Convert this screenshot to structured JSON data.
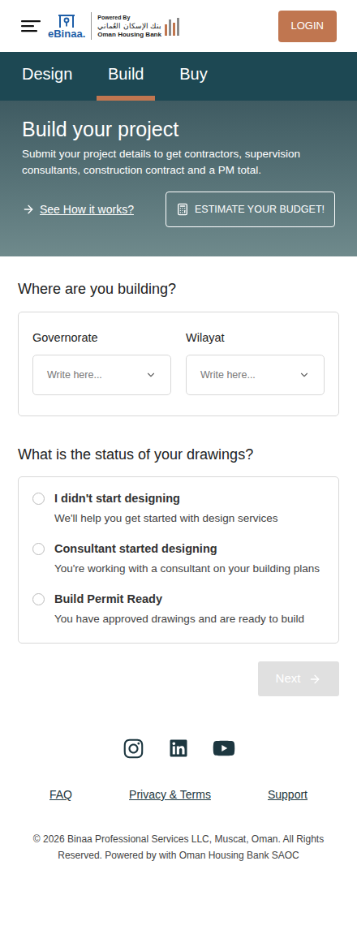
{
  "header": {
    "logo": {
      "name": "eBinaa.",
      "powered_by": "Powered By",
      "bank_arabic": "بنك الإسكان العُماني",
      "bank_english": "Oman Housing Bank"
    },
    "login": "LOGIN"
  },
  "tabs": [
    {
      "label": "Design",
      "selected": false
    },
    {
      "label": "Build",
      "selected": true
    },
    {
      "label": "Buy",
      "selected": false
    }
  ],
  "hero": {
    "title": "Build your project",
    "description": "Submit your project details to get contractors, supervision consultants, construction contract and a PM total.",
    "link": "See How it works?",
    "button": "ESTIMATE YOUR BUDGET!"
  },
  "location": {
    "title": "Where are you building?",
    "fields": [
      {
        "label": "Governorate",
        "placeholder": "Write here..."
      },
      {
        "label": "Wilayat",
        "placeholder": "Write here..."
      }
    ]
  },
  "drawings": {
    "title": "What is the status of your drawings?",
    "options": [
      {
        "title": "I didn't start designing",
        "description": "We'll help you get started with design services",
        "selected": false
      },
      {
        "title": "Consultant started designing",
        "description": "You're working with a consultant on your building plans",
        "selected": false
      },
      {
        "title": "Build Permit Ready",
        "description": "You have approved drawings and are ready to build",
        "selected": false
      }
    ]
  },
  "next": {
    "label": "Next",
    "disabled": true
  },
  "footer": {
    "links": [
      "FAQ",
      "Privacy & Terms",
      "Support"
    ],
    "copyright": "© 2026 Binaa Professional Services LLC, Muscat, Oman. All Rights Reserved. Powered by with Oman Housing Bank SAOC"
  }
}
